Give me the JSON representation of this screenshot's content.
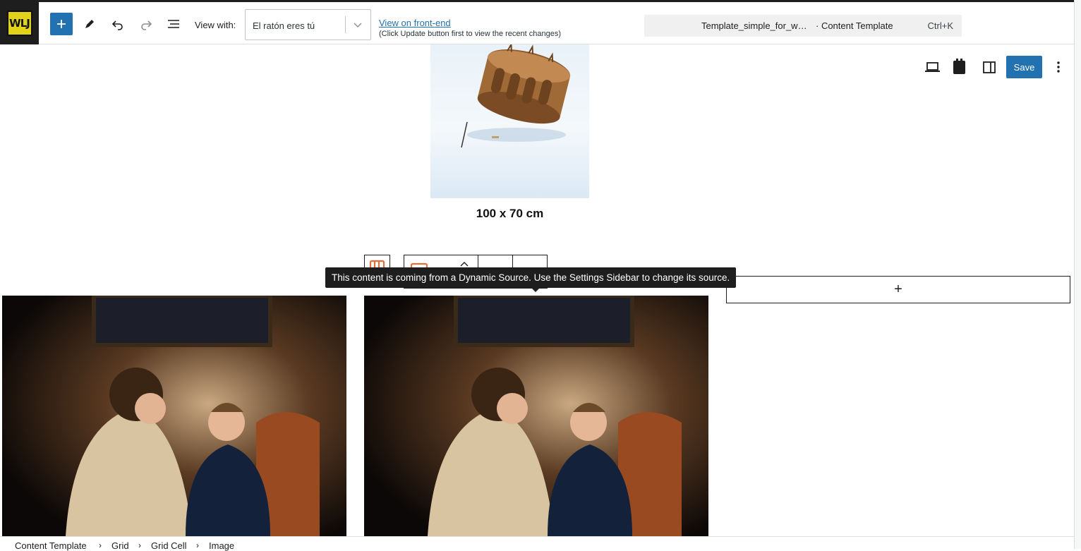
{
  "header": {
    "logo_text": "WLJ",
    "view_with_label": "View with:",
    "view_with_value": "El ratón eres tú",
    "view_front_end": "View on front-end",
    "view_note": "(Click Update button first to view the recent changes)",
    "command_title": "Template_simple_for_w…",
    "command_type": "· Content Template",
    "command_shortcut": "Ctrl+K",
    "save_label": "Save"
  },
  "content": {
    "caption": "100 x 70 cm",
    "tooltip": "This content is coming from a Dynamic Source. Use the Settings Sidebar to change its source.",
    "appender_symbol": "+"
  },
  "breadcrumb": {
    "items": [
      "Content Template",
      "Grid",
      "Grid Cell",
      "Image"
    ],
    "separator": "›"
  },
  "colors": {
    "accent": "#2271b1",
    "dark": "#1e1e1e"
  }
}
